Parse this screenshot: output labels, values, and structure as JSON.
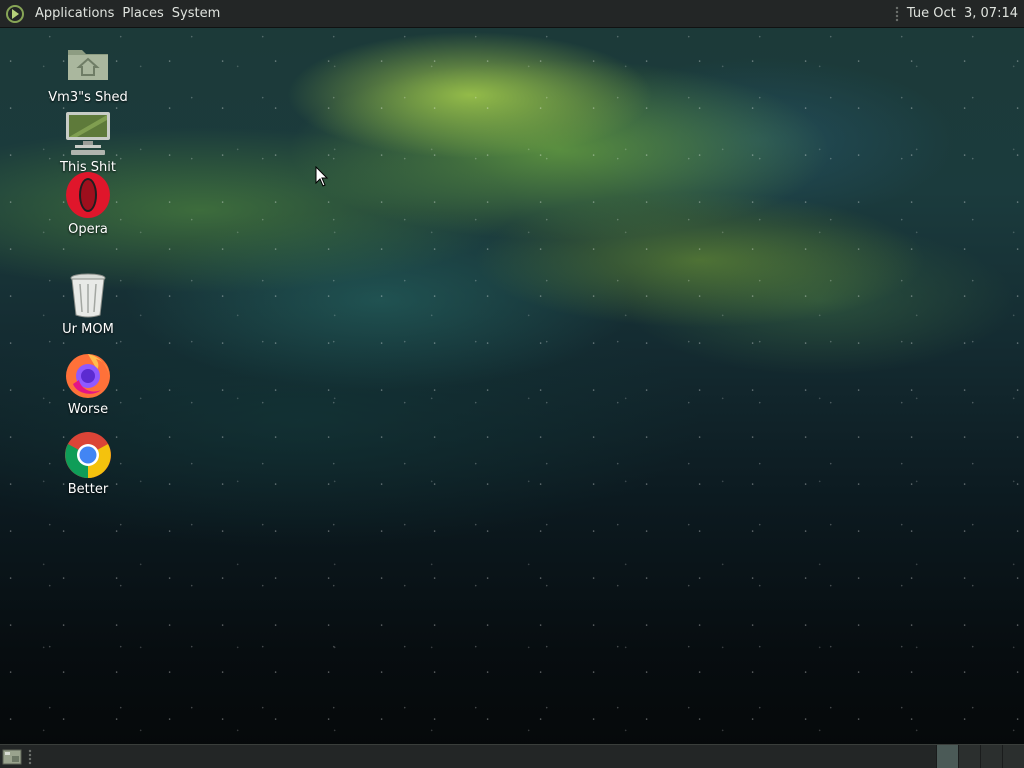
{
  "top_panel": {
    "menus": [
      "Applications",
      "Places",
      "System"
    ],
    "clock": "Tue Oct  3, 07:14"
  },
  "desktop": {
    "icons": [
      {
        "label": "Vm3\"s Shed",
        "icon": "home-folder-icon"
      },
      {
        "label": "This Shit",
        "icon": "computer-icon"
      },
      {
        "label": "Opera",
        "icon": "opera-icon"
      },
      {
        "label": "Ur MOM",
        "icon": "trash-icon"
      },
      {
        "label": "Worse",
        "icon": "firefox-icon"
      },
      {
        "label": "Better",
        "icon": "chrome-icon"
      }
    ]
  },
  "bottom_panel": {
    "workspaces": 4,
    "active_workspace": 1
  },
  "colors": {
    "panel_bg": "#232626",
    "panel_text": "#dfe3de",
    "accent_green": "#a5cd4b"
  }
}
